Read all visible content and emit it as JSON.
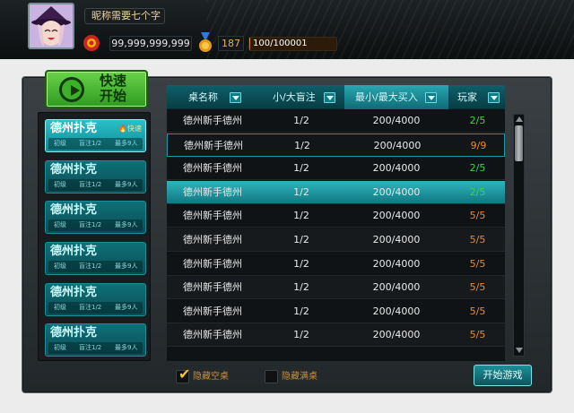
{
  "header": {
    "nickname": "昵称需要七个字",
    "coins": "99,999,999,999",
    "level": "187",
    "exp": {
      "text": "100/100001",
      "fraction": 0.001
    }
  },
  "quick_start": {
    "label_line1": "快速",
    "label_line2": "开始"
  },
  "rooms": [
    {
      "name": "德州扑克",
      "badge": "快速",
      "level": "初级",
      "blinds": "盲注1/2",
      "max": "最多9人",
      "selected": true
    },
    {
      "name": "德州扑克",
      "level": "初级",
      "blinds": "盲注1/2",
      "max": "最多9人",
      "selected": false
    },
    {
      "name": "德州扑克",
      "level": "初级",
      "blinds": "盲注1/2",
      "max": "最多9人",
      "selected": false
    },
    {
      "name": "德州扑克",
      "level": "初级",
      "blinds": "盲注1/2",
      "max": "最多9人",
      "selected": false
    },
    {
      "name": "德州扑克",
      "level": "初级",
      "blinds": "盲注1/2",
      "max": "最多9人",
      "selected": false
    },
    {
      "name": "德州扑克",
      "level": "初级",
      "blinds": "盲注1/2",
      "max": "最多9人",
      "selected": false
    }
  ],
  "table": {
    "headers": {
      "name": "桌名称",
      "blinds": "小/大盲注",
      "buyin": "最小/最大买入",
      "players": "玩家"
    },
    "rows": [
      {
        "name": "德州新手德州",
        "blinds": "1/2",
        "buyin": "200/4000",
        "players": "2/5",
        "color": "#3ed63e"
      },
      {
        "name": "德州新手德州",
        "blinds": "1/2",
        "buyin": "200/4000",
        "players": "9/9",
        "color": "#e98b2e"
      },
      {
        "name": "德州新手德州",
        "blinds": "1/2",
        "buyin": "200/4000",
        "players": "2/5",
        "color": "#3ed63e"
      },
      {
        "name": "德州新手德州",
        "blinds": "1/2",
        "buyin": "200/4000",
        "players": "2/5",
        "color": "#3ed63e"
      },
      {
        "name": "德州新手德州",
        "blinds": "1/2",
        "buyin": "200/4000",
        "players": "5/5",
        "color": "#e98b2e"
      },
      {
        "name": "德州新手德州",
        "blinds": "1/2",
        "buyin": "200/4000",
        "players": "5/5",
        "color": "#e98b2e"
      },
      {
        "name": "德州新手德州",
        "blinds": "1/2",
        "buyin": "200/4000",
        "players": "5/5",
        "color": "#e98b2e"
      },
      {
        "name": "德州新手德州",
        "blinds": "1/2",
        "buyin": "200/4000",
        "players": "5/5",
        "color": "#e98b2e"
      },
      {
        "name": "德州新手德州",
        "blinds": "1/2",
        "buyin": "200/4000",
        "players": "5/5",
        "color": "#e98b2e"
      },
      {
        "name": "德州新手德州",
        "blinds": "1/2",
        "buyin": "200/4000",
        "players": "5/5",
        "color": "#e98b2e"
      }
    ]
  },
  "filters": {
    "hide_empty": {
      "label": "隐藏空桌",
      "checked": true
    },
    "hide_full": {
      "label": "隐藏满桌",
      "checked": false
    }
  },
  "start_button": "开始游戏",
  "colors": {
    "accent": "#1a9aa3",
    "green": "#3ed63e",
    "orange": "#e98b2e"
  }
}
